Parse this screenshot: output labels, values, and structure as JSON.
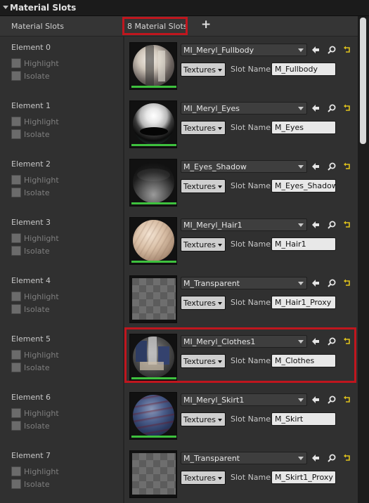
{
  "header": {
    "title": "Material Slots"
  },
  "slots": {
    "label": "Material Slots",
    "count": "8 Material Slots",
    "add_glyph": "+"
  },
  "labels": {
    "highlight": "Highlight",
    "isolate": "Isolate",
    "textures": "Textures",
    "slot_name": "Slot Name"
  },
  "elements": [
    {
      "name": "Element 0",
      "material": "MI_Meryl_Fullbody",
      "slot": "M_Fullbody"
    },
    {
      "name": "Element 1",
      "material": "MI_Meryl_Eyes",
      "slot": "M_Eyes"
    },
    {
      "name": "Element 2",
      "material": "M_Eyes_Shadow",
      "slot": "M_Eyes_Shadow"
    },
    {
      "name": "Element 3",
      "material": "MI_Meryl_Hair1",
      "slot": "M_Hair1"
    },
    {
      "name": "Element 4",
      "material": "M_Transparent",
      "slot": "M_Hair1_Proxy"
    },
    {
      "name": "Element 5",
      "material": "MI_Meryl_Clothes1",
      "slot": "M_Clothes"
    },
    {
      "name": "Element 6",
      "material": "MI_Meryl_Skirt1",
      "slot": "M_Skirt"
    },
    {
      "name": "Element 7",
      "material": "M_Transparent",
      "slot": "M_Skirt1_Proxy"
    }
  ],
  "icons": {
    "back": "arrow-left-icon",
    "find": "magnifier-icon",
    "reset": "reset-arrow-icon"
  },
  "colors": {
    "highlight_border": "#c0161e",
    "thumb_bar": "#3ec13e",
    "reset_icon": "#e0c31c"
  }
}
